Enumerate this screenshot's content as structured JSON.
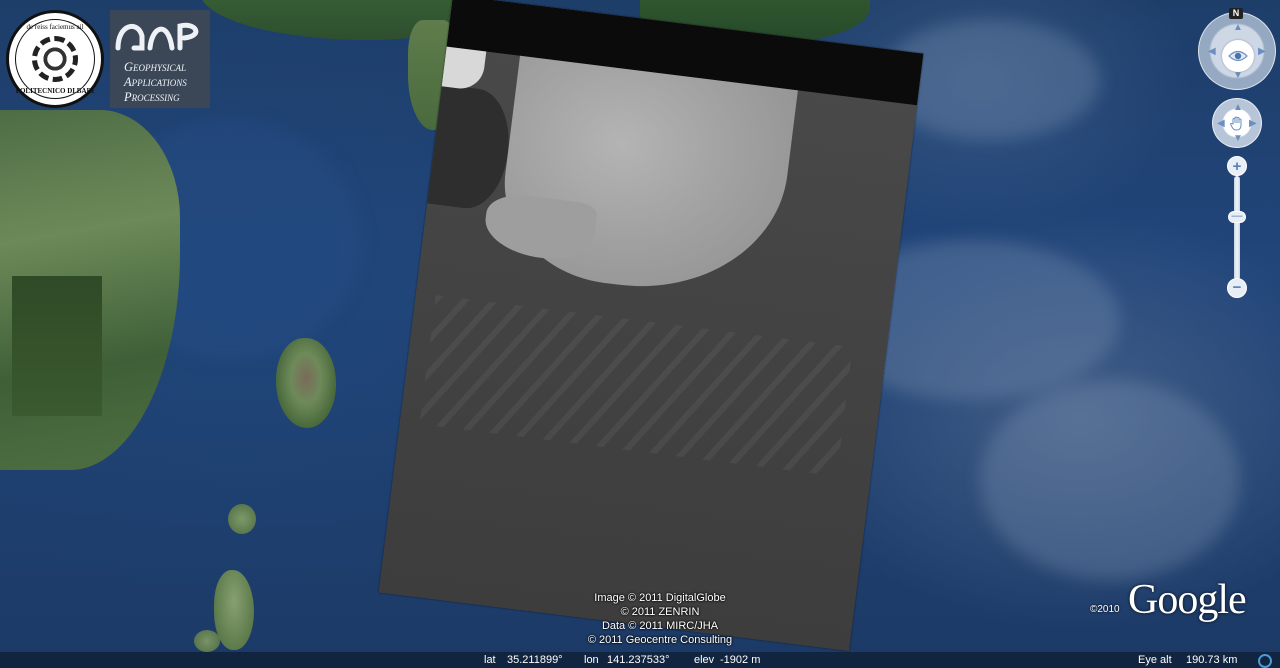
{
  "logos": {
    "poliba": {
      "motto": "de reiss faciemus ail",
      "name": "POLITECNICO DI BARI",
      "year": "1990"
    },
    "gap": {
      "mark": "GAP",
      "lines": [
        "Geophysical",
        "Applications",
        "Processing"
      ]
    }
  },
  "nav": {
    "north_label": "N",
    "zoom_in_label": "+",
    "zoom_out_label": "−",
    "zoom_level": 0.38
  },
  "attribution": {
    "lines": [
      "Image © 2011 DigitalGlobe",
      "© 2011 ZENRIN",
      "Data © 2011 MIRC/JHA",
      "© 2011 Geocentre Consulting"
    ]
  },
  "branding": {
    "year": "©2010",
    "name": "Google"
  },
  "status": {
    "lat_label": "lat",
    "lat_value": "35.211899°",
    "lon_label": "lon",
    "lon_value": "141.237533°",
    "elev_label": "elev",
    "elev_value": "-1902 m",
    "eye_alt_label": "Eye alt",
    "eye_alt_value": "190.73 km"
  }
}
